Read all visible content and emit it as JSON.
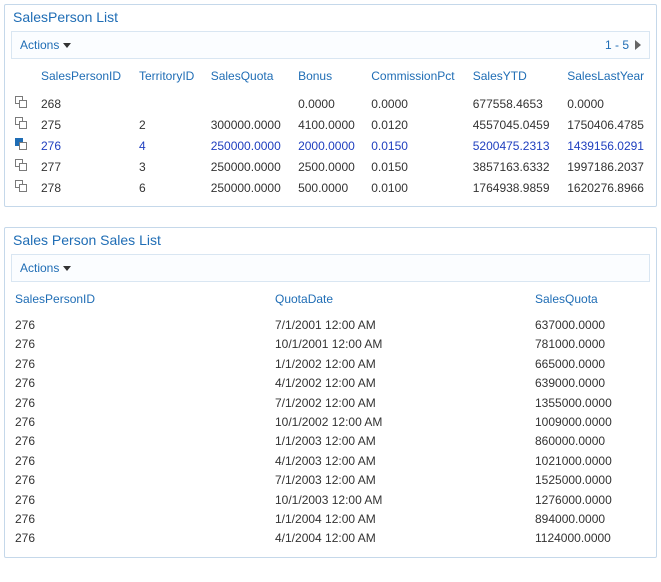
{
  "region1": {
    "title": "SalesPerson List",
    "actions_label": "Actions",
    "pagination": "1 - 5",
    "columns": [
      "SalesPersonID",
      "TerritoryID",
      "SalesQuota",
      "Bonus",
      "CommissionPct",
      "SalesYTD",
      "SalesLastYear"
    ],
    "rows": [
      {
        "active": false,
        "SalesPersonID": "268",
        "TerritoryID": "",
        "SalesQuota": "",
        "Bonus": "0.0000",
        "CommissionPct": "0.0000",
        "SalesYTD": "677558.4653",
        "SalesLastYear": "0.0000"
      },
      {
        "active": false,
        "SalesPersonID": "275",
        "TerritoryID": "2",
        "SalesQuota": "300000.0000",
        "Bonus": "4100.0000",
        "CommissionPct": "0.0120",
        "SalesYTD": "4557045.0459",
        "SalesLastYear": "1750406.4785"
      },
      {
        "active": true,
        "SalesPersonID": "276",
        "TerritoryID": "4",
        "SalesQuota": "250000.0000",
        "Bonus": "2000.0000",
        "CommissionPct": "0.0150",
        "SalesYTD": "5200475.2313",
        "SalesLastYear": "1439156.0291"
      },
      {
        "active": false,
        "SalesPersonID": "277",
        "TerritoryID": "3",
        "SalesQuota": "250000.0000",
        "Bonus": "2500.0000",
        "CommissionPct": "0.0150",
        "SalesYTD": "3857163.6332",
        "SalesLastYear": "1997186.2037"
      },
      {
        "active": false,
        "SalesPersonID": "278",
        "TerritoryID": "6",
        "SalesQuota": "250000.0000",
        "Bonus": "500.0000",
        "CommissionPct": "0.0100",
        "SalesYTD": "1764938.9859",
        "SalesLastYear": "1620276.8966"
      }
    ]
  },
  "region2": {
    "title": "Sales Person Sales List",
    "actions_label": "Actions",
    "columns": [
      "SalesPersonID",
      "QuotaDate",
      "SalesQuota"
    ],
    "rows": [
      {
        "SalesPersonID": "276",
        "QuotaDate": "7/1/2001 12:00 AM",
        "SalesQuota": "637000.0000"
      },
      {
        "SalesPersonID": "276",
        "QuotaDate": "10/1/2001 12:00 AM",
        "SalesQuota": "781000.0000"
      },
      {
        "SalesPersonID": "276",
        "QuotaDate": "1/1/2002 12:00 AM",
        "SalesQuota": "665000.0000"
      },
      {
        "SalesPersonID": "276",
        "QuotaDate": "4/1/2002 12:00 AM",
        "SalesQuota": "639000.0000"
      },
      {
        "SalesPersonID": "276",
        "QuotaDate": "7/1/2002 12:00 AM",
        "SalesQuota": "1355000.0000"
      },
      {
        "SalesPersonID": "276",
        "QuotaDate": "10/1/2002 12:00 AM",
        "SalesQuota": "1009000.0000"
      },
      {
        "SalesPersonID": "276",
        "QuotaDate": "1/1/2003 12:00 AM",
        "SalesQuota": "860000.0000"
      },
      {
        "SalesPersonID": "276",
        "QuotaDate": "4/1/2003 12:00 AM",
        "SalesQuota": "1021000.0000"
      },
      {
        "SalesPersonID": "276",
        "QuotaDate": "7/1/2003 12:00 AM",
        "SalesQuota": "1525000.0000"
      },
      {
        "SalesPersonID": "276",
        "QuotaDate": "10/1/2003 12:00 AM",
        "SalesQuota": "1276000.0000"
      },
      {
        "SalesPersonID": "276",
        "QuotaDate": "1/1/2004 12:00 AM",
        "SalesQuota": "894000.0000"
      },
      {
        "SalesPersonID": "276",
        "QuotaDate": "4/1/2004 12:00 AM",
        "SalesQuota": "1124000.0000"
      }
    ]
  }
}
